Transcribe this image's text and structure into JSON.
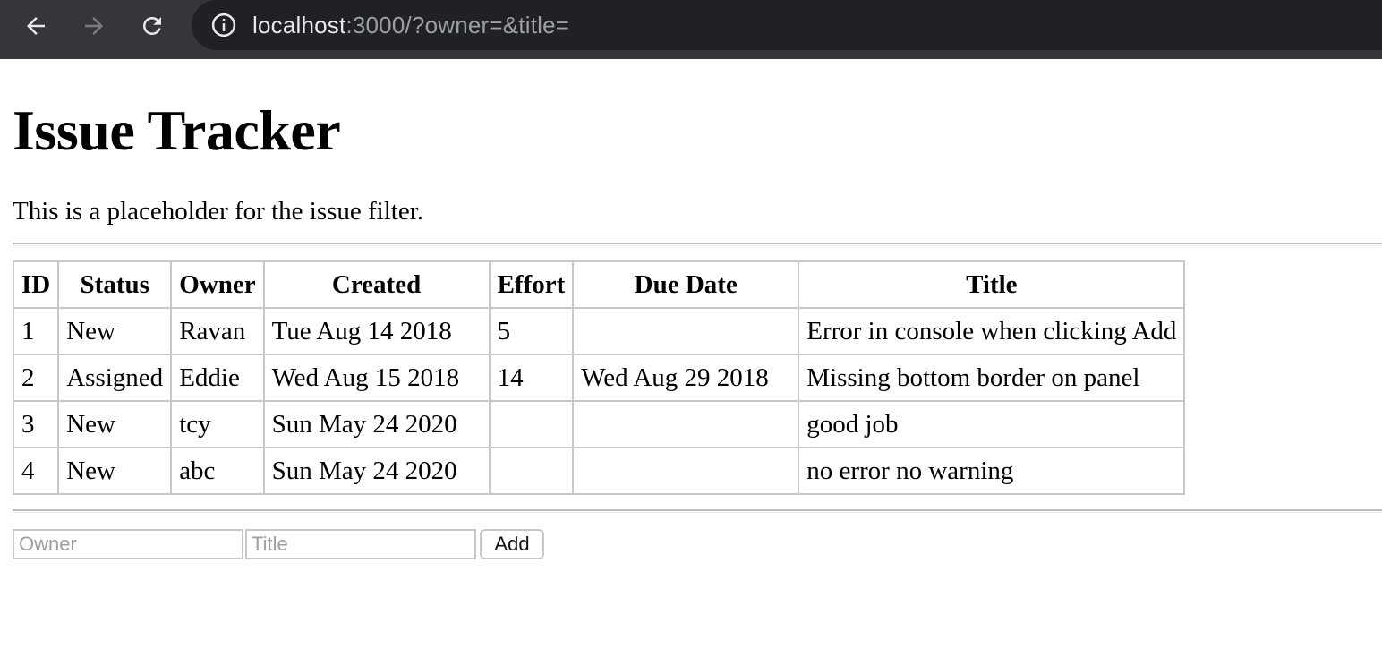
{
  "browser": {
    "url_host": "localhost",
    "url_rest": ":3000/?owner=&title=",
    "back_icon": "arrow-left-icon",
    "forward_icon": "arrow-right-icon",
    "reload_icon": "reload-icon",
    "info_icon": "info-icon"
  },
  "page": {
    "title": "Issue Tracker",
    "filter_text": "This is a placeholder for the issue filter."
  },
  "table": {
    "headers": [
      "ID",
      "Status",
      "Owner",
      "Created",
      "Effort",
      "Due Date",
      "Title"
    ],
    "rows": [
      [
        "1",
        "New",
        "Ravan",
        "Tue Aug 14 2018",
        "5",
        "",
        "Error in console when clicking Add"
      ],
      [
        "2",
        "Assigned",
        "Eddie",
        "Wed Aug 15 2018",
        "14",
        "Wed Aug 29 2018",
        "Missing bottom border on panel"
      ],
      [
        "3",
        "New",
        "tcy",
        "Sun May 24 2020",
        "",
        "",
        "good job"
      ],
      [
        "4",
        "New",
        "abc",
        "Sun May 24 2020",
        "",
        "",
        "no error no warning"
      ]
    ]
  },
  "form": {
    "owner_placeholder": "Owner",
    "owner_value": "",
    "title_placeholder": "Title",
    "title_value": "",
    "add_label": "Add"
  }
}
